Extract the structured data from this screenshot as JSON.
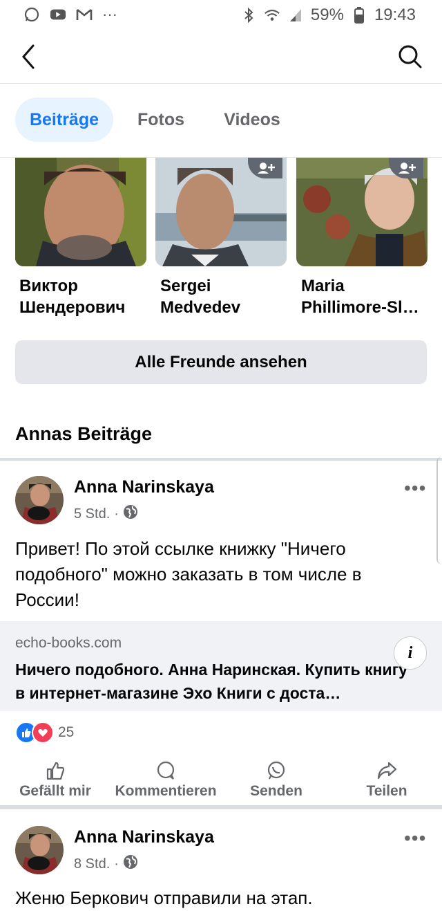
{
  "status_bar": {
    "battery": "59%",
    "time": "19:43",
    "ellipsis": "···"
  },
  "tabs": [
    {
      "label": "Beiträge",
      "active": true
    },
    {
      "label": "Fotos",
      "active": false
    },
    {
      "label": "Videos",
      "active": false
    }
  ],
  "friends": [
    {
      "name": "Виктор\nШендерович"
    },
    {
      "name": "Sergei\nMedvedev"
    },
    {
      "name": "Maria\nPhillimore-Sl…"
    }
  ],
  "all_friends_label": "Alle Freunde ansehen",
  "section_title": "Annas Beiträge",
  "posts": [
    {
      "author": "Anna Narinskaya",
      "time": "5 Std.",
      "text": "Привет! По этой ссылке книжку \"Ничего подобного\" можно заказать в том числе в России!",
      "link": {
        "domain": "echo-books.com",
        "title": "Ничего подобного. Анна Наринская. Купить книгу в интернет-магазине Эхо Книги с доста…",
        "info": "i"
      },
      "reaction_count": "25"
    },
    {
      "author": "Anna Narinskaya",
      "time": "8 Std.",
      "text": "Женю Беркович отправили на этап."
    }
  ],
  "actions": {
    "like": "Gefällt mir",
    "comment": "Kommentieren",
    "send": "Senden",
    "share": "Teilen"
  },
  "more_label": "•••",
  "meta_dot": "·",
  "colors": {
    "accent": "#1877f2",
    "like": "#1877f2",
    "love": "#f33e58"
  }
}
